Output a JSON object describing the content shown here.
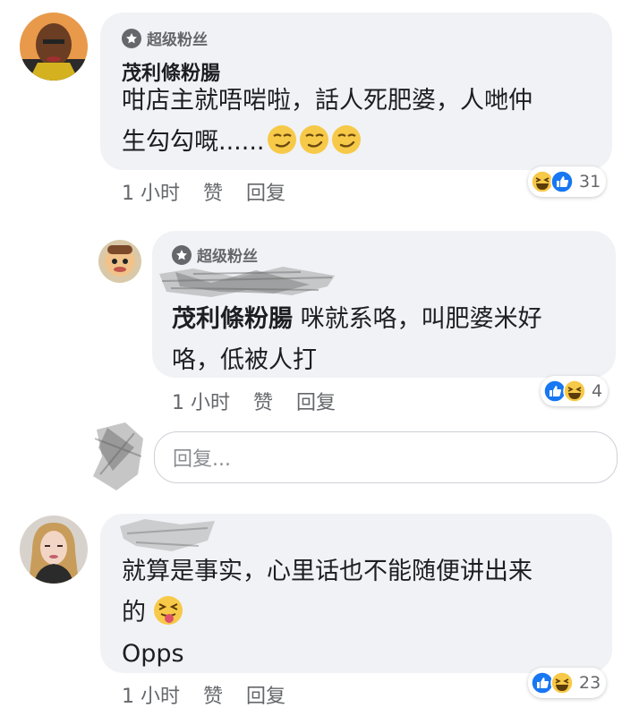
{
  "comments": [
    {
      "badge": "超级粉丝",
      "author": "茂利條粉腸",
      "line1": "咁店主就唔啱啦，話人死肥婆，人哋仲",
      "line2": "生勾勾嘅......",
      "emojis": [
        "smirk-emoji",
        "smirk-emoji",
        "smirk-emoji"
      ],
      "meta": {
        "time": "1 小时",
        "like": "赞",
        "reply": "回复"
      },
      "reactions": {
        "icons": [
          "haha-icon",
          "like-icon"
        ],
        "count": "31"
      }
    },
    {
      "badge": "超级粉丝",
      "reply_to": "茂利條粉腸",
      "line1": " 咪就系咯，叫肥婆米好",
      "line2": "咯，低被人打",
      "meta": {
        "time": "1 小时",
        "like": "赞",
        "reply": "回复"
      },
      "reactions": {
        "icons": [
          "like-icon",
          "haha-icon"
        ],
        "count": "4"
      }
    },
    {
      "line1": "就算是事实，心里话也不能随便讲出来",
      "line2": "的",
      "emojis": [
        "tongue-out-emoji"
      ],
      "line3": "Opps",
      "meta": {
        "time": "1 小时",
        "like": "赞",
        "reply": "回复"
      },
      "reactions": {
        "icons": [
          "like-icon",
          "haha-icon"
        ],
        "count": "23"
      }
    }
  ],
  "reply_input": {
    "placeholder": "回复..."
  },
  "colors": {
    "bubble": "#f0f2f5",
    "like_blue": "#1877f2",
    "haha_yellow": "#f7c948",
    "meta_gray": "#65676b"
  }
}
